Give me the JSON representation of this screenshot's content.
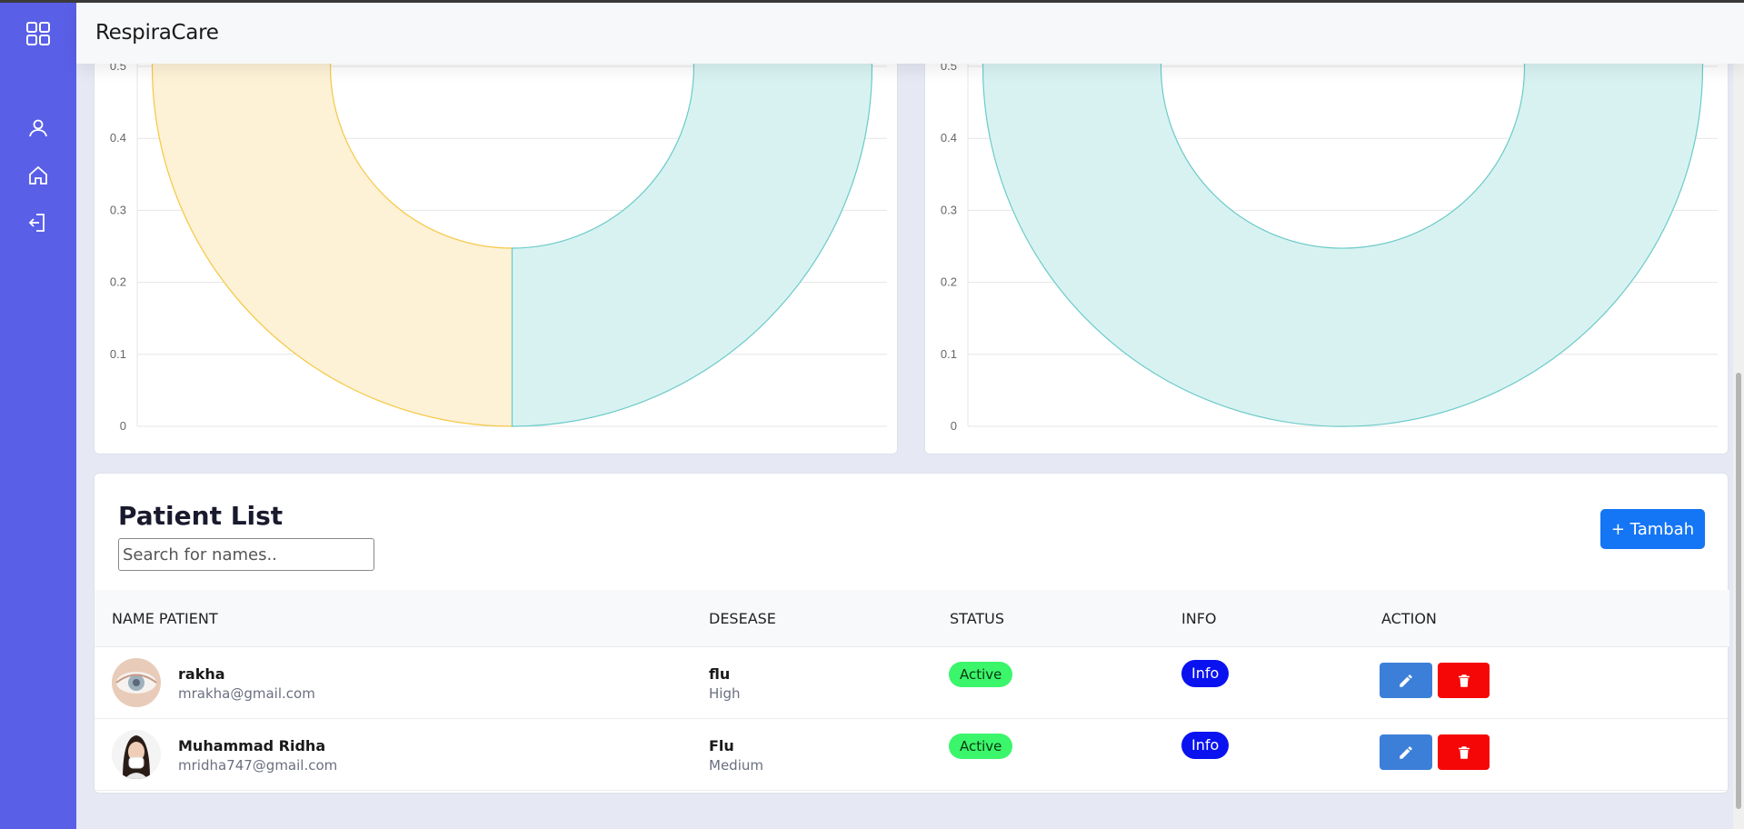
{
  "app": {
    "title": "RespiraCare"
  },
  "sidebar": {
    "icons": [
      "grid-icon",
      "user-icon",
      "home-icon",
      "logout-icon"
    ]
  },
  "chart_data": [
    {
      "type": "pie",
      "variant": "doughnut",
      "y_ticks": [
        "0",
        "0.1",
        "0.2",
        "0.3",
        "0.4",
        "0.5"
      ],
      "ylim": [
        0,
        0.5
      ],
      "grid": true,
      "slices": [
        {
          "value": 1,
          "color": "#f5d36b"
        },
        {
          "value": 1,
          "color": "#7fd3d0"
        }
      ],
      "colors": {
        "yellow_fill": "#fdf1d6",
        "yellow_stroke": "#f5c842",
        "teal_fill": "#d8f2f2",
        "teal_stroke": "#6bcbc8"
      }
    },
    {
      "type": "pie",
      "variant": "doughnut",
      "y_ticks": [
        "0",
        "0.1",
        "0.2",
        "0.3",
        "0.4",
        "0.5"
      ],
      "ylim": [
        0,
        0.5
      ],
      "grid": true,
      "slices": [
        {
          "value": 1,
          "color": "#7fd3d0"
        }
      ],
      "colors": {
        "teal_fill": "#d8f2f2",
        "teal_stroke": "#6bcbc8"
      }
    }
  ],
  "patients_section": {
    "title": "Patient List",
    "search_placeholder": "Search for names..",
    "add_button": "+ Tambah",
    "columns": [
      "NAME PATIENT",
      "DESEASE",
      "STATUS",
      "INFO",
      "ACTION"
    ],
    "rows": [
      {
        "name": "rakha",
        "email": "mrakha@gmail.com",
        "disease": "flu",
        "level": "High",
        "status": "Active",
        "info": "Info"
      },
      {
        "name": "Muhammad Ridha",
        "email": "mridha747@gmail.com",
        "disease": "Flu",
        "level": "Medium",
        "status": "Active",
        "info": "Info"
      }
    ]
  }
}
